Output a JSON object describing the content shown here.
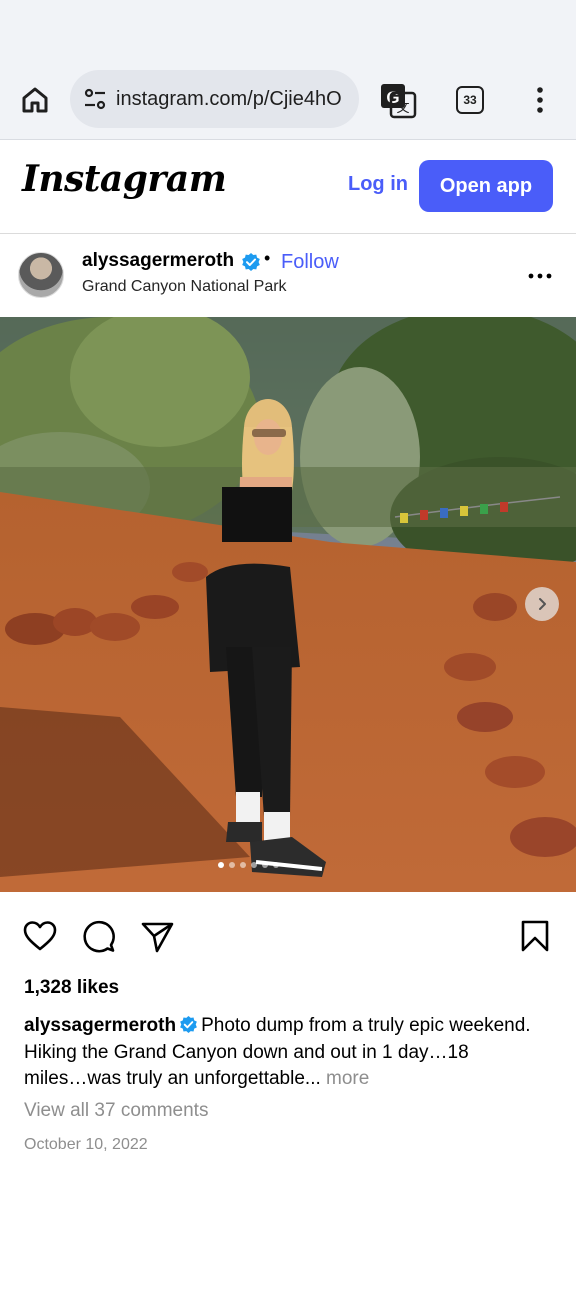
{
  "browser": {
    "url": "instagram.com/p/Cjie4hO",
    "tab_count": "33"
  },
  "header": {
    "logo_text": "Instagram",
    "login_label": "Log in",
    "open_app_label": "Open app",
    "accent_color": "#4a5df9"
  },
  "post": {
    "username": "alyssagermeroth",
    "verified": true,
    "separator": "•",
    "follow_label": "Follow",
    "location": "Grand Canyon National Park",
    "photo_alt": "carousel photo",
    "carousel": {
      "current": 1,
      "total": 6
    },
    "likes": "1,328 likes",
    "caption_user": "alyssagermeroth",
    "caption_text": "Photo dump from a truly epic weekend. Hiking the Grand Canyon down and out in 1 day…18 miles…was truly an unforgettable...",
    "caption_more": "more",
    "view_comments": "View all 37 comments",
    "date": "October 10, 2022"
  },
  "icons": {
    "home": "home-icon",
    "site_settings": "tune-icon",
    "translate": "translate-icon",
    "menu": "more-vert-icon",
    "like": "heart-icon",
    "comment": "comment-icon",
    "share": "send-icon",
    "save": "bookmark-icon",
    "verified": "verified-badge-icon",
    "options": "more-horiz-icon",
    "next": "chevron-right-icon"
  }
}
